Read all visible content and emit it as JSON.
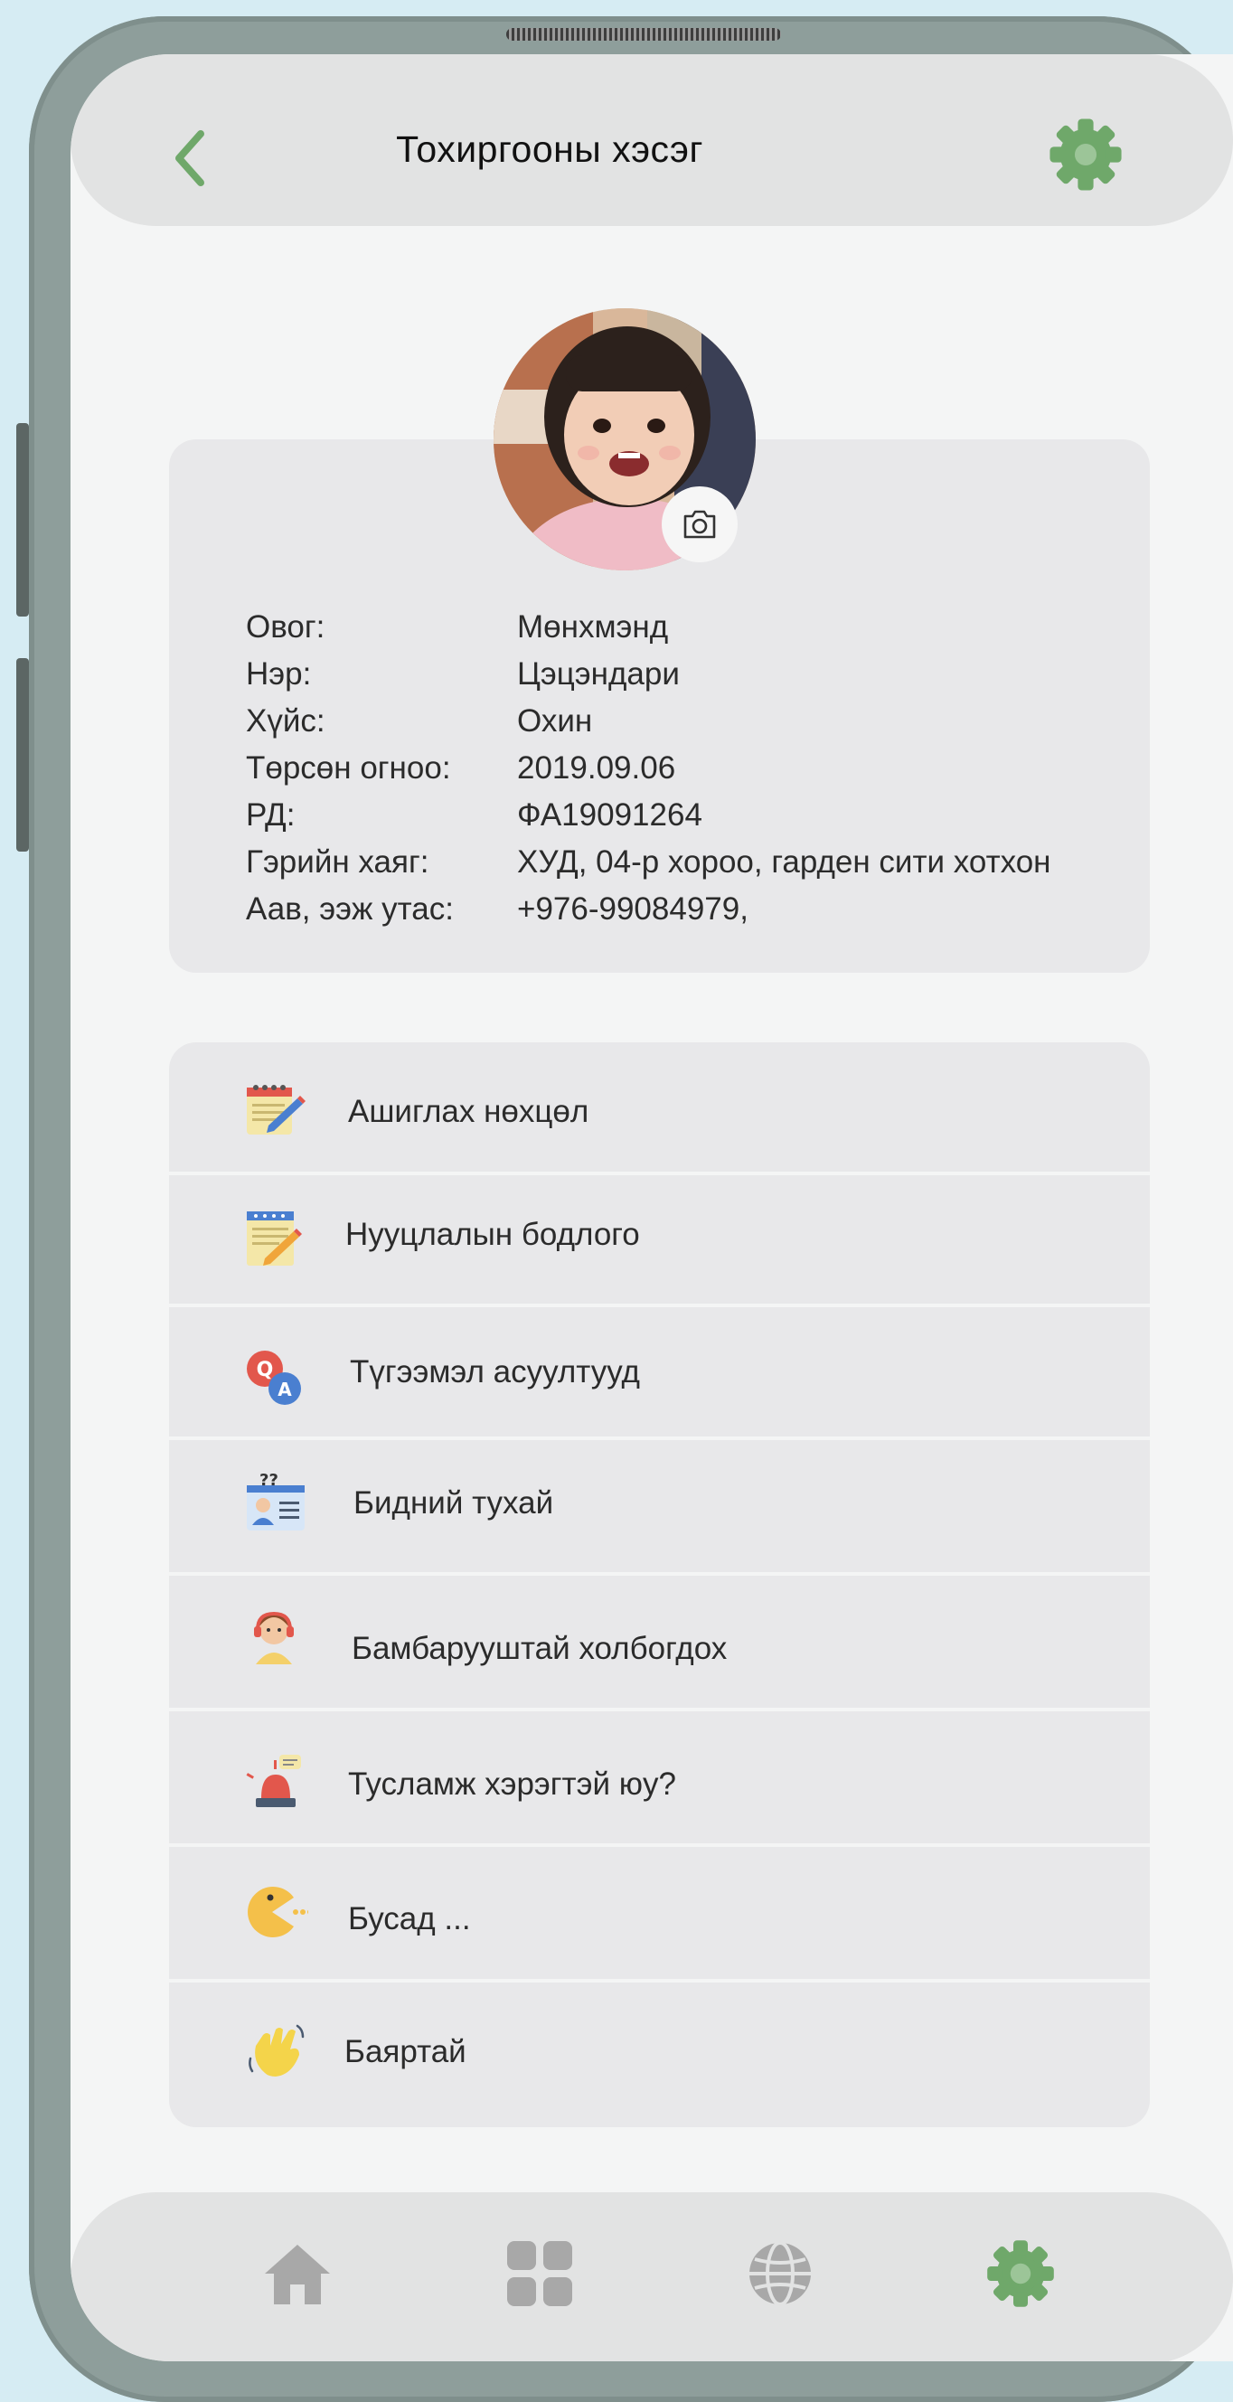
{
  "header": {
    "title": "Тохиргооны хэсэг"
  },
  "profile": {
    "rows": [
      {
        "label": "Овог:",
        "value": "Мөнхмэнд"
      },
      {
        "label": "Нэр:",
        "value": "Цэцэндари"
      },
      {
        "label": "Хүйс:",
        "value": "Охин"
      },
      {
        "label": "Төрсөн огноо:",
        "value": "2019.09.06"
      },
      {
        "label": "РД:",
        "value": "ФА19091264"
      },
      {
        "label": "Гэрийн хаяг:",
        "value": "ХУД, 04-р хороо, гарден сити хотхон"
      },
      {
        "label": "Аав, ээж утас:",
        "value": "+976-99084979,"
      }
    ]
  },
  "menu": {
    "items": [
      {
        "label": "Ашиглах нөхцөл",
        "icon": "notepad-pencil-icon"
      },
      {
        "label": "Нууцлалын бодлого",
        "icon": "document-pencil-icon"
      },
      {
        "label": "Түгээмэл асуултууд",
        "icon": "q-and-a-icon"
      },
      {
        "label": "Бидний тухай",
        "icon": "profile-card-icon"
      },
      {
        "label": "Бамбарууштай холбогдох",
        "icon": "support-agent-icon"
      },
      {
        "label": "Тусламж хэрэгтэй юу?",
        "icon": "alarm-siren-icon"
      },
      {
        "label": "Бусад ...",
        "icon": "pacman-icon"
      },
      {
        "label": "Баяртай",
        "icon": "waving-hand-icon"
      }
    ]
  },
  "nav": {
    "items": [
      "home-icon",
      "grid-icon",
      "globe-icon",
      "gear-icon"
    ],
    "active": "gear-icon"
  },
  "colors": {
    "accent_green": "#6fa86a",
    "nav_inactive": "#a8a8a8",
    "header_bg": "#e2e3e3",
    "card_bg": "#e8e8ea"
  }
}
